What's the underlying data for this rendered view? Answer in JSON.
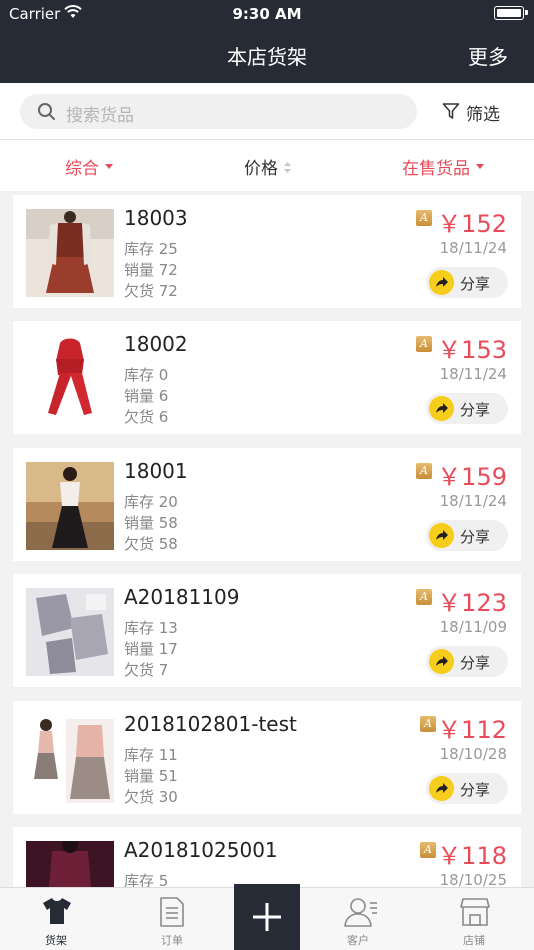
{
  "status_bar": {
    "carrier": "Carrier",
    "time": "9:30 AM"
  },
  "nav": {
    "title": "本店货架",
    "more": "更多"
  },
  "search": {
    "placeholder": "搜索货品",
    "filter_label": "筛选"
  },
  "sort": {
    "composite": "综合",
    "price": "价格",
    "on_sale": "在售货品"
  },
  "products": [
    {
      "name": "18003",
      "stock": "库存 25",
      "sales": "销量 72",
      "owed": "欠货 72",
      "badge": "A",
      "price": "￥152",
      "date": "18/11/24",
      "share": "分享"
    },
    {
      "name": "18002",
      "stock": "库存 0",
      "sales": "销量 6",
      "owed": "欠货 6",
      "badge": "A",
      "price": "￥153",
      "date": "18/11/24",
      "share": "分享"
    },
    {
      "name": "18001",
      "stock": "库存 20",
      "sales": "销量 58",
      "owed": "欠货 58",
      "badge": "A",
      "price": "￥159",
      "date": "18/11/24",
      "share": "分享"
    },
    {
      "name": "A20181109",
      "stock": "库存 13",
      "sales": "销量 17",
      "owed": "欠货 7",
      "badge": "A",
      "price": "￥123",
      "date": "18/11/09",
      "share": "分享"
    },
    {
      "name": "2018102801-test",
      "stock": "库存 11",
      "sales": "销量 51",
      "owed": "欠货 30",
      "badge": "A",
      "price": "￥112",
      "date": "18/10/28",
      "share": "分享"
    },
    {
      "name": "A20181025001",
      "stock": "库存 5",
      "badge": "A",
      "price": "￥118",
      "date": "18/10/25"
    }
  ],
  "tabs": {
    "goods": "货架",
    "orders": "订单",
    "customers": "客户",
    "shop": "店铺"
  },
  "colors": {
    "header_bg": "#262b36",
    "accent_red": "#e84c5a",
    "share_yellow": "#f7cd1b"
  }
}
